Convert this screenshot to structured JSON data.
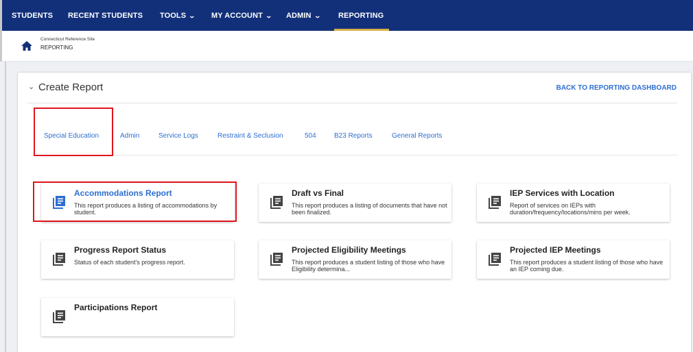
{
  "nav": {
    "items": [
      {
        "label": "STUDENTS"
      },
      {
        "label": "RECENT STUDENTS"
      },
      {
        "label": "TOOLS"
      },
      {
        "label": "MY ACCOUNT"
      },
      {
        "label": "ADMIN"
      },
      {
        "label": "REPORTING"
      }
    ],
    "active": "REPORTING",
    "active_underline_color": "#d8b047",
    "background_color": "#12307a"
  },
  "breadcrumb": {
    "site": "Connecticut Reference Site",
    "page": "REPORTING"
  },
  "panel": {
    "title": "Create Report",
    "back_link": "BACK TO REPORTING DASHBOARD"
  },
  "tabs": [
    {
      "label": "Special Education"
    },
    {
      "label": "Admin"
    },
    {
      "label": "Service Logs"
    },
    {
      "label": "Restraint & Seclusion"
    },
    {
      "label": "504"
    },
    {
      "label": "B23 Reports"
    },
    {
      "label": "General Reports"
    }
  ],
  "reports": [
    {
      "title": "Accommodations Report",
      "description": "This report produces a listing of accommodations by student.",
      "icon": "report-icon",
      "highlighted": true
    },
    {
      "title": "Draft vs Final",
      "description": "This report produces a listing of documents that have not been finalized.",
      "icon": "report-icon"
    },
    {
      "title": "IEP Services with Location",
      "description": "Report of services on IEPs with duration/frequency/locations/mins per week.",
      "icon": "report-icon"
    },
    {
      "title": "Progress Report Status",
      "description": "Status of each student's progress report.",
      "icon": "report-icon"
    },
    {
      "title": "Projected Eligibility Meetings",
      "description": "This report produces a student listing of those who have Eligibility determina...",
      "icon": "report-icon"
    },
    {
      "title": "Projected IEP Meetings",
      "description": "This report produces a student listing of those who have an IEP coming due.",
      "icon": "report-icon"
    },
    {
      "title": "Participations Report",
      "description": "",
      "icon": "report-icon"
    }
  ],
  "colors": {
    "link_blue": "#2e6ed1",
    "highlight_red": "#e0141b"
  }
}
